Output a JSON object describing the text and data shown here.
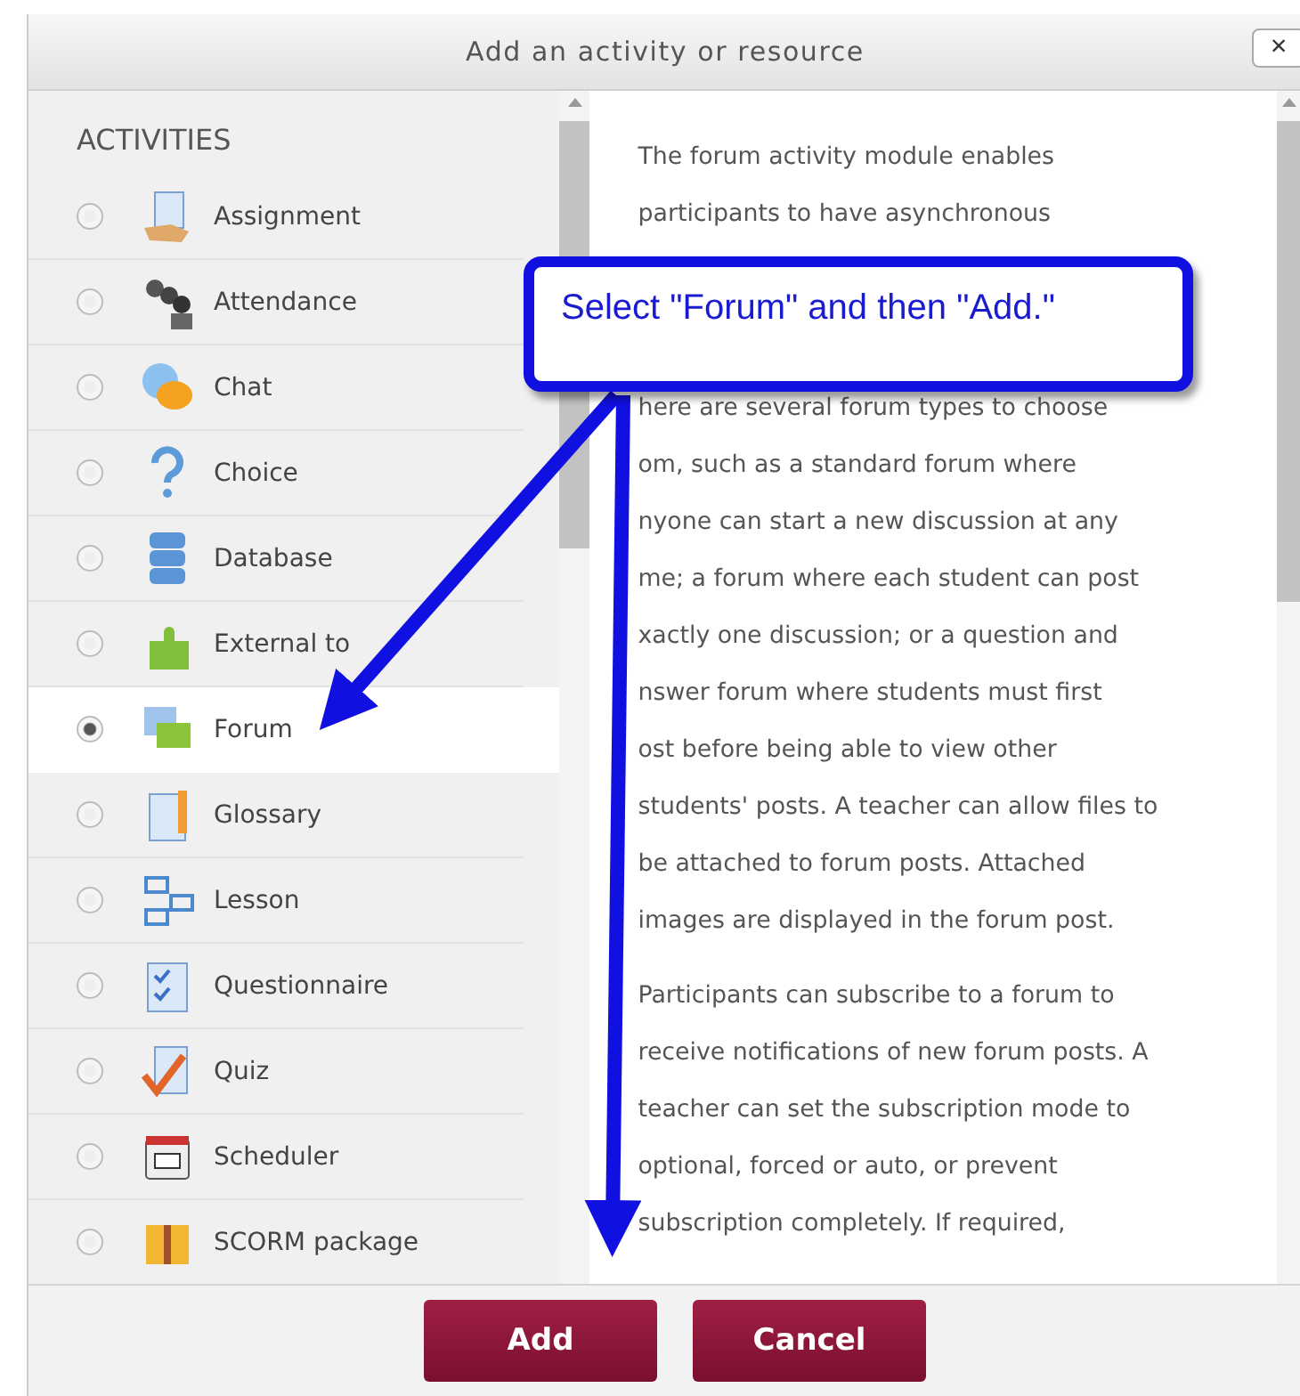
{
  "dialog": {
    "title": "Add an activity or resource",
    "close": "×"
  },
  "activities": {
    "heading": "ACTIVITIES",
    "items": [
      {
        "label": "Assignment",
        "selected": false
      },
      {
        "label": "Attendance",
        "selected": false
      },
      {
        "label": "Chat",
        "selected": false
      },
      {
        "label": "Choice",
        "selected": false
      },
      {
        "label": "Database",
        "selected": false
      },
      {
        "label": "External to",
        "selected": false
      },
      {
        "label": "Forum",
        "selected": true
      },
      {
        "label": "Glossary",
        "selected": false
      },
      {
        "label": "Lesson",
        "selected": false
      },
      {
        "label": "Questionnaire",
        "selected": false
      },
      {
        "label": "Quiz",
        "selected": false
      },
      {
        "label": "Scheduler",
        "selected": false
      },
      {
        "label": "SCORM package",
        "selected": false
      }
    ]
  },
  "description": {
    "top_lines": [
      "The forum activity module enables",
      "participants to have asynchronous"
    ],
    "paragraphs": [
      [
        "here are several forum types to choose",
        "om, such as a standard forum where",
        "nyone can start a new discussion at any",
        "me; a forum where each student can post",
        "xactly one discussion; or a question and",
        "nswer forum where students must first",
        "ost before being able to view other",
        "students' posts. A teacher can allow files to",
        "be attached to forum posts. Attached",
        "images are displayed in the forum post."
      ],
      [
        "Participants can subscribe to a forum to",
        "receive notifications of new forum posts. A",
        "teacher can set the subscription mode to",
        "optional, forced or auto, or prevent",
        "subscription completely. If required,"
      ]
    ]
  },
  "callout": {
    "text": "Select \"Forum\" and then \"Add.\""
  },
  "buttons": [
    "Add",
    "Cancel"
  ]
}
